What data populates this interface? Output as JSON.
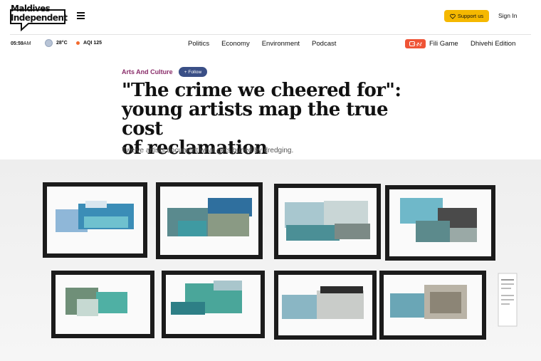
{
  "brand": {
    "logo_line1": "Maldives",
    "logo_line2": "Independent"
  },
  "header": {
    "menu_icon": "hamburger-menu-icon",
    "support_label": "Support us",
    "support_icon": "heart-icon",
    "support_color": "#f5b800",
    "signin_label": "Sign In"
  },
  "status": {
    "time_hours": "05:59",
    "time_suffix": "AM",
    "temperature": "28°C",
    "aqi": "AQI 125",
    "aqi_color": "#f26a2e"
  },
  "nav": {
    "items": [
      "Politics",
      "Economy",
      "Environment",
      "Podcast"
    ],
    "fili_badge": "ފިލި",
    "fili_label": "Fili Game",
    "fili_color": "#ef5436",
    "edition_label": "Dhivehi Edition"
  },
  "article": {
    "category": "Arts And Culture",
    "follow_label": "+ Follow",
    "title_line1": "\"The crime we cheered for\":",
    "title_line2": "young artists map the true cost",
    "title_line3": "of reclamation",
    "subtitle": "Twelve artists document what gets buried by dredging.",
    "accent_color": "#8a2d6a",
    "follow_color": "#3a4f86"
  }
}
